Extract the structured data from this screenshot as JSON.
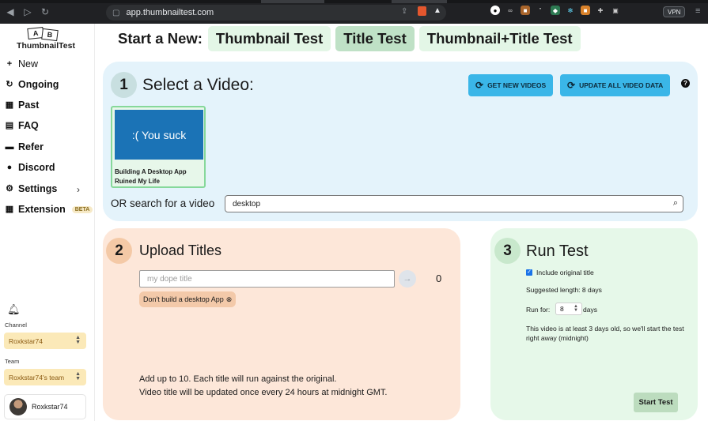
{
  "browser": {
    "url": "app.thumbnailtest.com",
    "vpn_label": "VPN"
  },
  "sidebar": {
    "logo": {
      "card_a": "A",
      "card_b": "B",
      "name": "ThumbnailTest"
    },
    "items": [
      {
        "label": "New",
        "icon": "plus-icon"
      },
      {
        "label": "Ongoing",
        "icon": "refresh-icon"
      },
      {
        "label": "Past",
        "icon": "grid-icon"
      },
      {
        "label": "FAQ",
        "icon": "book-icon"
      },
      {
        "label": "Refer",
        "icon": "card-icon"
      },
      {
        "label": "Discord",
        "icon": "chat-icon"
      },
      {
        "label": "Settings",
        "icon": "gear-icon"
      },
      {
        "label": "Extension",
        "icon": "grid-icon",
        "badge": "BETA"
      }
    ],
    "channel_label": "Channel",
    "channel_value": "Roxkstar74",
    "team_label": "Team",
    "team_value": "Roxkstar74's team",
    "user_name": "Roxkstar74"
  },
  "header": {
    "start_label": "Start a New:",
    "tabs": [
      {
        "label": "Thumbnail Test",
        "active": false
      },
      {
        "label": "Title Test",
        "active": true
      },
      {
        "label": "Thumbnail+Title Test",
        "active": false
      }
    ]
  },
  "step1": {
    "number": "1",
    "title": "Select a Video:",
    "get_new_videos": "GET NEW VIDEOS",
    "update_all": "UPDATE ALL VIDEO DATA",
    "help": "?",
    "video": {
      "thumb_text": ":(  You suck",
      "title": "Building A Desktop App Ruined My Life"
    },
    "or_search_label": "OR search for a video",
    "search_value": "desktop"
  },
  "step2": {
    "number": "2",
    "title": "Upload Titles",
    "input_placeholder": "my dope title",
    "count": "0",
    "tag_text": "Don't build a desktop App",
    "note1": "Add up to 10. Each title will run against the original.",
    "note2": "Video title will be updated once every 24 hours at midnight GMT."
  },
  "step3": {
    "number": "3",
    "title": "Run Test",
    "include_original": "Include original title",
    "include_original_checked": true,
    "suggested_length": "Suggested length: 8 days",
    "run_for_label": "Run for:",
    "run_for_value": "8",
    "days_label": "days",
    "note": "This video is at least 3 days old, so we'll start the test right away (midnight)",
    "start_button": "Start Test"
  },
  "colors": {
    "panel1_bg": "#e4f3fb",
    "panel2_bg": "#fde7d9",
    "panel3_bg": "#e6f8e9",
    "accent_blue": "#3ab6e8",
    "tab_green": "#e3f6e6",
    "tab_green_active": "#bfe1c6"
  }
}
